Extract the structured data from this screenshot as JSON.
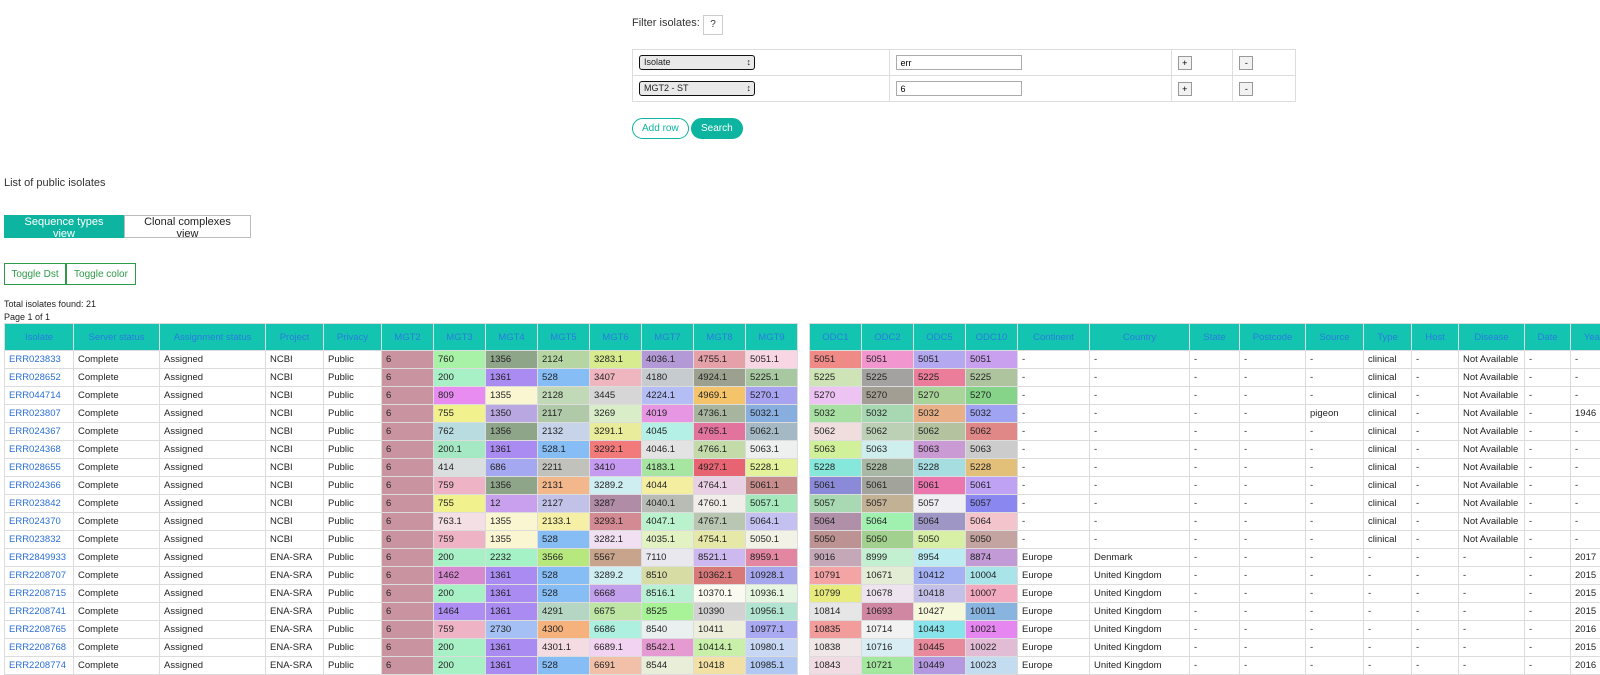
{
  "filter": {
    "label": "Filter isolates:",
    "help_label": "?",
    "rows": [
      {
        "field": "Isolate",
        "value": "err",
        "add_label": "+",
        "remove_label": "-"
      },
      {
        "field": "MGT2 - ST",
        "value": "6",
        "add_label": "+",
        "remove_label": "-"
      }
    ],
    "add_row_label": "Add row",
    "search_label": "Search"
  },
  "list": {
    "title": "List of public isolates",
    "views": [
      "Sequence types view",
      "Clonal complexes view"
    ],
    "toggles": [
      "Toggle Dst",
      "Toggle color"
    ],
    "total": "Total isolates found: 21",
    "page": "Page 1 of 1"
  },
  "colors": {
    "accent": "#13c4b0",
    "link": "#2a6ed6",
    "mgt2_cell": "#c9939f"
  },
  "table": {
    "headers": [
      "Isolate",
      "Server status",
      "Assignment status",
      "Project",
      "Privacy",
      "MGT2",
      "MGT3",
      "MGT4",
      "MGT5",
      "MGT6",
      "MGT7",
      "MGT8",
      "MGT9",
      "",
      "ODC1",
      "ODC2",
      "ODC5",
      "ODC10",
      "Continent",
      "Country",
      "State",
      "Postcode",
      "Source",
      "Type",
      "Host",
      "Disease",
      "Date",
      "Year"
    ],
    "rows": [
      {
        "cells": [
          "ERR023833",
          "Complete",
          "Assigned",
          "NCBI",
          "Public",
          "6",
          "760",
          "1356",
          "2124",
          "3283.1",
          "4036.1",
          "4755.1",
          "5051.1",
          "",
          "5051",
          "5051",
          "5051",
          "5051",
          "-",
          "-",
          "-",
          "-",
          "-",
          "clinical",
          "-",
          "Not Available",
          "-",
          "-"
        ],
        "colors": {
          "5": "#c9939f",
          "6": "#a8f2a8",
          "7": "#8fa58a",
          "8": "#b5d6a3",
          "9": "#d7eb8f",
          "10": "#b39ad6",
          "11": "#e6a0a8",
          "12": "#f8d6e4",
          "14": "#f08a86",
          "15": "#f296cf",
          "16": "#b4a8f0",
          "17": "#c9a0ef"
        }
      },
      {
        "cells": [
          "ERR028652",
          "Complete",
          "Assigned",
          "NCBI",
          "Public",
          "6",
          "200",
          "1361",
          "528",
          "3407",
          "4180",
          "4924.1",
          "5225.1",
          "",
          "5225",
          "5225",
          "5225",
          "5225",
          "-",
          "-",
          "-",
          "-",
          "-",
          "clinical",
          "-",
          "Not Available",
          "-",
          "-"
        ],
        "colors": {
          "5": "#c9939f",
          "6": "#a8f0c6",
          "7": "#a98bf2",
          "8": "#86bdf5",
          "9": "#f0b6c0",
          "10": "#c6cbd0",
          "11": "#9ca08e",
          "12": "#a8c8a2",
          "14": "#cfe4b6",
          "15": "#a4a2a0",
          "16": "#ec7d9a",
          "17": "#aec49f"
        }
      },
      {
        "cells": [
          "ERR044714",
          "Complete",
          "Assigned",
          "NCBI",
          "Public",
          "6",
          "809",
          "1355",
          "2128",
          "3445",
          "4224.1",
          "4969.1",
          "5270.1",
          "",
          "5270",
          "5270",
          "5270",
          "5270",
          "-",
          "-",
          "-",
          "-",
          "-",
          "clinical",
          "-",
          "Not Available",
          "-",
          "-"
        ],
        "colors": {
          "5": "#c9939f",
          "6": "#e98cf2",
          "7": "#fbf6d2",
          "8": "#c2d9b8",
          "9": "#d6d6d6",
          "10": "#b4bdf4",
          "11": "#f4c36a",
          "12": "#a8a3f0",
          "14": "#ecc3f2",
          "15": "#a39e93",
          "16": "#a9d49a",
          "17": "#86d48a"
        }
      },
      {
        "cells": [
          "ERR023807",
          "Complete",
          "Assigned",
          "NCBI",
          "Public",
          "6",
          "755",
          "1350",
          "2117",
          "3269",
          "4019",
          "4736.1",
          "5032.1",
          "",
          "5032",
          "5032",
          "5032",
          "5032",
          "-",
          "-",
          "-",
          "-",
          "pigeon",
          "clinical",
          "-",
          "Not Available",
          "-",
          "1946"
        ],
        "colors": {
          "5": "#c9939f",
          "6": "#f1f18e",
          "7": "#b8a7e0",
          "8": "#b0c9a8",
          "9": "#d9edc8",
          "10": "#e796e3",
          "11": "#a8b59e",
          "12": "#88aee0",
          "14": "#a8e0a4",
          "15": "#a7d8b2",
          "16": "#e9b088",
          "17": "#a0a3f2"
        }
      },
      {
        "cells": [
          "ERR024367",
          "Complete",
          "Assigned",
          "NCBI",
          "Public",
          "6",
          "762",
          "1356",
          "2132",
          "3291.1",
          "4045",
          "4765.1",
          "5062.1",
          "",
          "5062",
          "5062",
          "5062",
          "5062",
          "-",
          "-",
          "-",
          "-",
          "-",
          "clinical",
          "-",
          "Not Available",
          "-",
          "-"
        ],
        "colors": {
          "5": "#c9939f",
          "6": "#b9dce0",
          "7": "#8fa58a",
          "8": "#c7d3e8",
          "9": "#e9ec9a",
          "10": "#b5f0e6",
          "11": "#e2739c",
          "12": "#a4b9c3",
          "14": "#f0dede",
          "15": "#bcd0b5",
          "16": "#b4c2a0",
          "17": "#e08888"
        }
      },
      {
        "cells": [
          "ERR024368",
          "Complete",
          "Assigned",
          "NCBI",
          "Public",
          "6",
          "200.1",
          "1361",
          "528.1",
          "3292.1",
          "4046.1",
          "4766.1",
          "5063.1",
          "",
          "5063",
          "5063",
          "5063",
          "5063",
          "-",
          "-",
          "-",
          "-",
          "-",
          "clinical",
          "-",
          "Not Available",
          "-",
          "-"
        ],
        "colors": {
          "5": "#c9939f",
          "6": "#a4e8c4",
          "7": "#a98bf2",
          "8": "#86bdf5",
          "9": "#f27a7a",
          "10": "#e3e3e3",
          "11": "#c3dba8",
          "12": "#eef0f0",
          "14": "#d1f09a",
          "15": "#cfeeee",
          "16": "#ca9ad4",
          "17": "#cccccc"
        }
      },
      {
        "cells": [
          "ERR028655",
          "Complete",
          "Assigned",
          "NCBI",
          "Public",
          "6",
          "414",
          "686",
          "2211",
          "3410",
          "4183.1",
          "4927.1",
          "5228.1",
          "",
          "5228",
          "5228",
          "5228",
          "5228",
          "-",
          "-",
          "-",
          "-",
          "-",
          "clinical",
          "-",
          "Not Available",
          "-",
          "-"
        ],
        "colors": {
          "5": "#c9939f",
          "6": "#d9dede",
          "7": "#a4a8f0",
          "8": "#c2c2bd",
          "9": "#c59af0",
          "10": "#a6e6a0",
          "11": "#e86472",
          "12": "#e4f29c",
          "14": "#86e8da",
          "15": "#a8b8a4",
          "16": "#a6dde0",
          "17": "#e2c07a"
        }
      },
      {
        "cells": [
          "ERR024366",
          "Complete",
          "Assigned",
          "NCBI",
          "Public",
          "6",
          "759",
          "1356",
          "2131",
          "3289.2",
          "4044",
          "4764.1",
          "5061.1",
          "",
          "5061",
          "5061",
          "5061",
          "5061",
          "-",
          "-",
          "-",
          "-",
          "-",
          "clinical",
          "-",
          "Not Available",
          "-",
          "-"
        ],
        "colors": {
          "5": "#c9939f",
          "6": "#eeb4c6",
          "7": "#8fa58a",
          "8": "#f2b78a",
          "9": "#cfeef2",
          "10": "#f3eea0",
          "11": "#e9d0e4",
          "12": "#c78d8d",
          "14": "#8a8ad8",
          "15": "#a2a49b",
          "16": "#ec76ae",
          "17": "#c0a2f5"
        }
      },
      {
        "cells": [
          "ERR023842",
          "Complete",
          "Assigned",
          "NCBI",
          "Public",
          "6",
          "755",
          "12",
          "2127",
          "3287",
          "4040.1",
          "4760.1",
          "5057.1",
          "",
          "5057",
          "5057",
          "5057",
          "5057",
          "-",
          "-",
          "-",
          "-",
          "-",
          "clinical",
          "-",
          "Not Available",
          "-",
          "-"
        ],
        "colors": {
          "5": "#c9939f",
          "6": "#f1f18e",
          "7": "#c9a0ee",
          "8": "#c2c2e8",
          "9": "#b08ca6",
          "10": "#b8bcb4",
          "11": "#f1ede8",
          "12": "#a4e8bc",
          "14": "#a8d9b2",
          "15": "#c2b195",
          "16": "#f0f0f4",
          "17": "#8a88f0"
        }
      },
      {
        "cells": [
          "ERR024370",
          "Complete",
          "Assigned",
          "NCBI",
          "Public",
          "6",
          "763.1",
          "1355",
          "2133.1",
          "3293.1",
          "4047.1",
          "4767.1",
          "5064.1",
          "",
          "5064",
          "5064",
          "5064",
          "5064",
          "-",
          "-",
          "-",
          "-",
          "-",
          "clinical",
          "-",
          "Not Available",
          "-",
          "-"
        ],
        "colors": {
          "5": "#c9939f",
          "6": "#f3dfe4",
          "7": "#fbf6d2",
          "8": "#f6f0a6",
          "9": "#d38a92",
          "10": "#b9f2cc",
          "11": "#b8c6b2",
          "12": "#c4c0f0",
          "14": "#b090a8",
          "15": "#a0f0b0",
          "16": "#9e96c4",
          "17": "#f4c4cc"
        }
      },
      {
        "cells": [
          "ERR023832",
          "Complete",
          "Assigned",
          "NCBI",
          "Public",
          "6",
          "759",
          "1355",
          "528",
          "3282.1",
          "4035.1",
          "4754.1",
          "5050.1",
          "",
          "5050",
          "5050",
          "5050",
          "5050",
          "-",
          "-",
          "-",
          "-",
          "-",
          "clinical",
          "-",
          "Not Available",
          "-",
          "-"
        ],
        "colors": {
          "5": "#c9939f",
          "6": "#eeb4c6",
          "7": "#fbf6d2",
          "8": "#86bdf5",
          "9": "#f0e0f2",
          "10": "#e2f2c2",
          "11": "#e6e8a8",
          "12": "#f2f2e6",
          "14": "#bc9292",
          "15": "#a2d08e",
          "16": "#d7f0a6",
          "17": "#c4a4a0"
        }
      },
      {
        "cells": [
          "ERR2849933",
          "Complete",
          "Assigned",
          "ENA-SRA",
          "Public",
          "6",
          "200",
          "2232",
          "3566",
          "5567",
          "7110",
          "8521.1",
          "8959.1",
          "",
          "9016",
          "8999",
          "8954",
          "8874",
          "Europe",
          "Denmark",
          "-",
          "-",
          "-",
          "-",
          "-",
          "-",
          "-",
          "2017"
        ],
        "colors": {
          "5": "#c9939f",
          "6": "#a8f0c6",
          "7": "#a4f2c6",
          "8": "#b7e87e",
          "9": "#c8a48c",
          "10": "#e8e8ee",
          "11": "#cdb8f0",
          "12": "#e286a2",
          "14": "#c4a8b8",
          "15": "#c4f0d2",
          "16": "#bcecf2",
          "17": "#c29ad6"
        }
      },
      {
        "cells": [
          "ERR2208707",
          "Complete",
          "Assigned",
          "ENA-SRA",
          "Public",
          "6",
          "1462",
          "1361",
          "528",
          "3289.2",
          "8510",
          "10362.1",
          "10928.1",
          "",
          "10791",
          "10671",
          "10412",
          "10004",
          "Europe",
          "United Kingdom",
          "-",
          "-",
          "-",
          "-",
          "-",
          "-",
          "-",
          "2015"
        ],
        "colors": {
          "5": "#c9939f",
          "6": "#d88ad0",
          "7": "#a98bf2",
          "8": "#86bdf5",
          "9": "#cfeef2",
          "10": "#d7dca4",
          "11": "#d87878",
          "12": "#a6a6ec",
          "14": "#f4a4a4",
          "15": "#e3ecd4",
          "16": "#a4b2f4",
          "17": "#a8e4e8"
        }
      },
      {
        "cells": [
          "ERR2208715",
          "Complete",
          "Assigned",
          "ENA-SRA",
          "Public",
          "6",
          "200",
          "1361",
          "528",
          "6668",
          "8516.1",
          "10370.1",
          "10936.1",
          "",
          "10799",
          "10678",
          "10418",
          "10007",
          "Europe",
          "United Kingdom",
          "-",
          "-",
          "-",
          "-",
          "-",
          "-",
          "-",
          "2015"
        ],
        "colors": {
          "5": "#c9939f",
          "6": "#a8f0c6",
          "7": "#a98bf2",
          "8": "#86bdf5",
          "9": "#c3a0ec",
          "10": "#b8f0d4",
          "11": "#fafaf0",
          "12": "#e6f6e0",
          "14": "#e8ec7e",
          "15": "#eee4f0",
          "16": "#c4c0e8",
          "17": "#f2aac0"
        }
      },
      {
        "cells": [
          "ERR2208741",
          "Complete",
          "Assigned",
          "ENA-SRA",
          "Public",
          "6",
          "1464",
          "1361",
          "4291",
          "6675",
          "8525",
          "10390",
          "10956.1",
          "",
          "10814",
          "10693",
          "10427",
          "10011",
          "Europe",
          "United Kingdom",
          "-",
          "-",
          "-",
          "-",
          "-",
          "-",
          "-",
          "2015"
        ],
        "colors": {
          "5": "#c9939f",
          "6": "#ae8ef2",
          "7": "#a98bf2",
          "8": "#b6d6c4",
          "9": "#bde5a4",
          "10": "#a8f298",
          "11": "#d2d2d2",
          "12": "#b2e4d2",
          "14": "#e6e6e6",
          "15": "#d088a2",
          "16": "#f6f8dc",
          "17": "#8ab4e0"
        }
      },
      {
        "cells": [
          "ERR2208765",
          "Complete",
          "Assigned",
          "ENA-SRA",
          "Public",
          "6",
          "759",
          "2730",
          "4300",
          "6686",
          "8540",
          "10411",
          "10977.1",
          "",
          "10835",
          "10714",
          "10443",
          "10021",
          "Europe",
          "United Kingdom",
          "-",
          "-",
          "-",
          "-",
          "-",
          "-",
          "-",
          "2016"
        ],
        "colors": {
          "5": "#c9939f",
          "6": "#eeb4c6",
          "7": "#a4c0f4",
          "8": "#f6b27c",
          "9": "#aef0e0",
          "10": "#eaf0f0",
          "11": "#eeeedc",
          "12": "#aaaaf2",
          "14": "#f29c9c",
          "15": "#f2f2f2",
          "16": "#88e4ea",
          "17": "#e686f0"
        }
      },
      {
        "cells": [
          "ERR2208768",
          "Complete",
          "Assigned",
          "ENA-SRA",
          "Public",
          "6",
          "200",
          "1361",
          "4301.1",
          "6689.1",
          "8542.1",
          "10414.1",
          "10980.1",
          "",
          "10838",
          "10716",
          "10445",
          "10022",
          "Europe",
          "United Kingdom",
          "-",
          "-",
          "-",
          "-",
          "-",
          "-",
          "-",
          "2015"
        ],
        "colors": {
          "5": "#c9939f",
          "6": "#a8f0c6",
          "7": "#a98bf2",
          "8": "#f4dce2",
          "9": "#f2d4f2",
          "10": "#e59ad2",
          "11": "#c8f0a8",
          "12": "#c8d8f4",
          "14": "#f0e8e8",
          "15": "#d8eef4",
          "16": "#e88a9c",
          "17": "#e2bcd4"
        }
      },
      {
        "cells": [
          "ERR2208774",
          "Complete",
          "Assigned",
          "ENA-SRA",
          "Public",
          "6",
          "200",
          "1361",
          "528",
          "6691",
          "8544",
          "10418",
          "10985.1",
          "",
          "10843",
          "10721",
          "10449",
          "10023",
          "Europe",
          "United Kingdom",
          "-",
          "-",
          "-",
          "-",
          "-",
          "-",
          "-",
          "2016"
        ],
        "colors": {
          "5": "#c9939f",
          "6": "#a8f0c6",
          "7": "#a98bf2",
          "8": "#86bdf5",
          "9": "#f2c0a8",
          "10": "#e8eed8",
          "11": "#f2e0a4",
          "12": "#b0c8f2",
          "14": "#f2dce4",
          "15": "#a4e8a0",
          "16": "#b498e0",
          "17": "#c4dcf0"
        }
      }
    ]
  }
}
